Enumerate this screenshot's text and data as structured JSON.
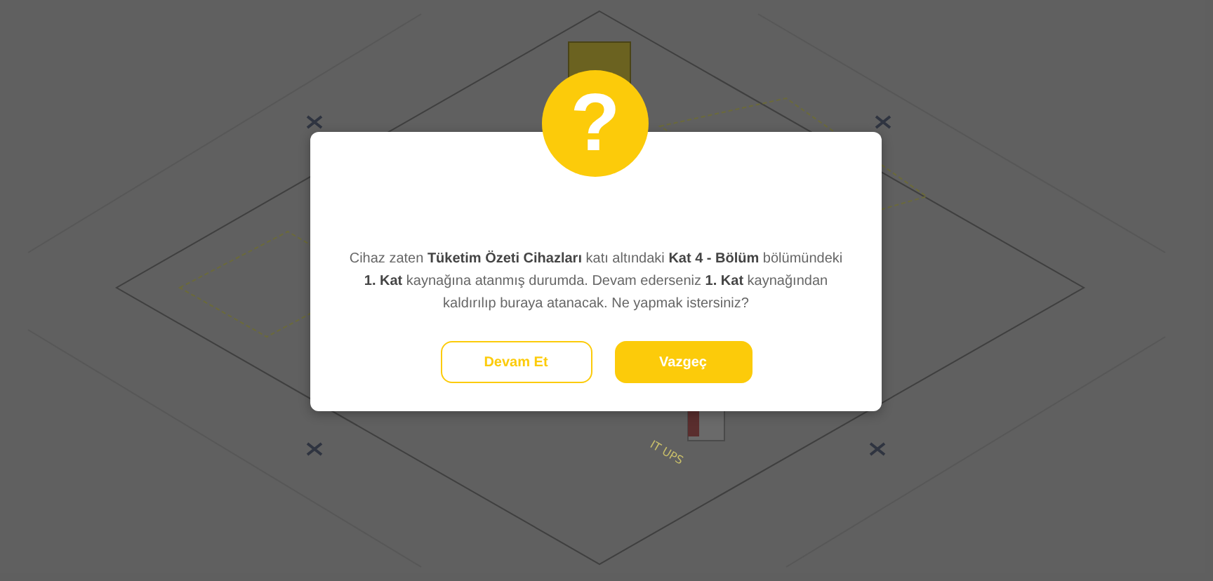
{
  "diagram": {
    "labels": [
      {
        "text": "IT UPS"
      }
    ]
  },
  "dialog": {
    "icon": "?",
    "message": "Cihaz zaten **Tüketim Özeti Cihazları** katı altındaki **Kat 4 - Bölüm** bölümündeki **1. Kat** kaynağına atanmış durumda. Devam ederseniz **1. Kat** kaynağından kaldırılıp buraya atanacak. Ne yapmak istersiniz?",
    "buttons": [
      {
        "label": "Devam Et",
        "kind": "outline"
      },
      {
        "label": "Vazgeç",
        "kind": "primary"
      }
    ]
  }
}
